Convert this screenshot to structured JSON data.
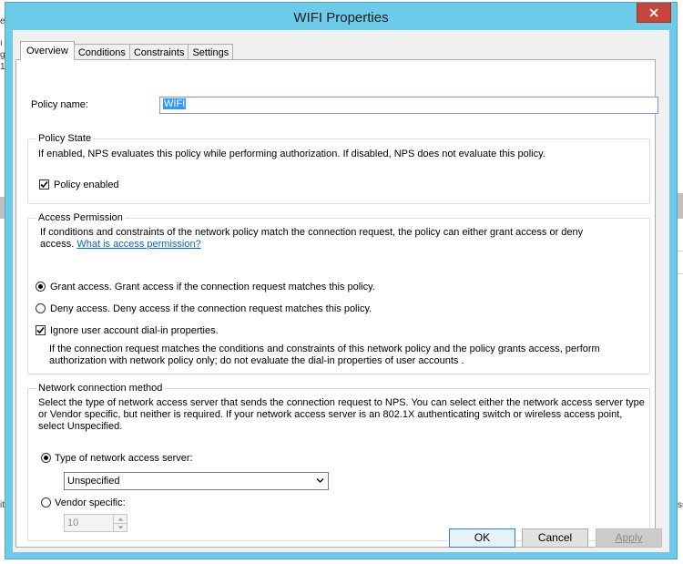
{
  "background": {
    "left_fragments": [
      "e",
      "ı",
      "g",
      "1",
      "it"
    ],
    "right_fragment": "ss"
  },
  "window": {
    "title": "WIFI Properties",
    "close_icon": "close-icon"
  },
  "tabs": [
    {
      "label": "Overview",
      "active": true
    },
    {
      "label": "Conditions",
      "active": false
    },
    {
      "label": "Constraints",
      "active": false
    },
    {
      "label": "Settings",
      "active": false
    }
  ],
  "policy_name": {
    "label": "Policy name:",
    "value": "WIFI"
  },
  "policy_state": {
    "title": "Policy State",
    "description": "If enabled, NPS evaluates this policy while performing authorization. If disabled, NPS does not evaluate this policy.",
    "enabled_label": "Policy enabled",
    "enabled_checked": true
  },
  "access_permission": {
    "title": "Access Permission",
    "description_line1": "If conditions and constraints of the network policy match the connection request, the policy can either grant access or deny",
    "description_line2": "access.",
    "link": "What is access permission?",
    "grant_label": "Grant access. Grant access if the connection request matches this policy.",
    "grant_checked": true,
    "deny_label": "Deny access. Deny access if the connection request matches this policy.",
    "deny_checked": false,
    "ignore_label": "Ignore user account dial-in properties.",
    "ignore_checked": true,
    "ignore_note_line1": "If the connection request matches the conditions and constraints of this network policy and the policy grants access, perform",
    "ignore_note_line2": "authorization with network policy only; do not evaluate the dial-in properties of user accounts ."
  },
  "network_connection": {
    "title": "Network connection method",
    "description_line1": "Select the type of network access server that sends the connection request to NPS. You can select either the network access server type",
    "description_line2": "or Vendor specific, but neither is required.  If your network access server is an 802.1X authenticating switch or wireless access point,",
    "description_line3": "select Unspecified.",
    "type_label": "Type of network access server:",
    "type_checked": true,
    "type_value": "Unspecified",
    "vendor_label": "Vendor specific:",
    "vendor_checked": false,
    "vendor_value": "10"
  },
  "buttons": {
    "ok": "OK",
    "cancel": "Cancel",
    "apply": "Apply"
  }
}
